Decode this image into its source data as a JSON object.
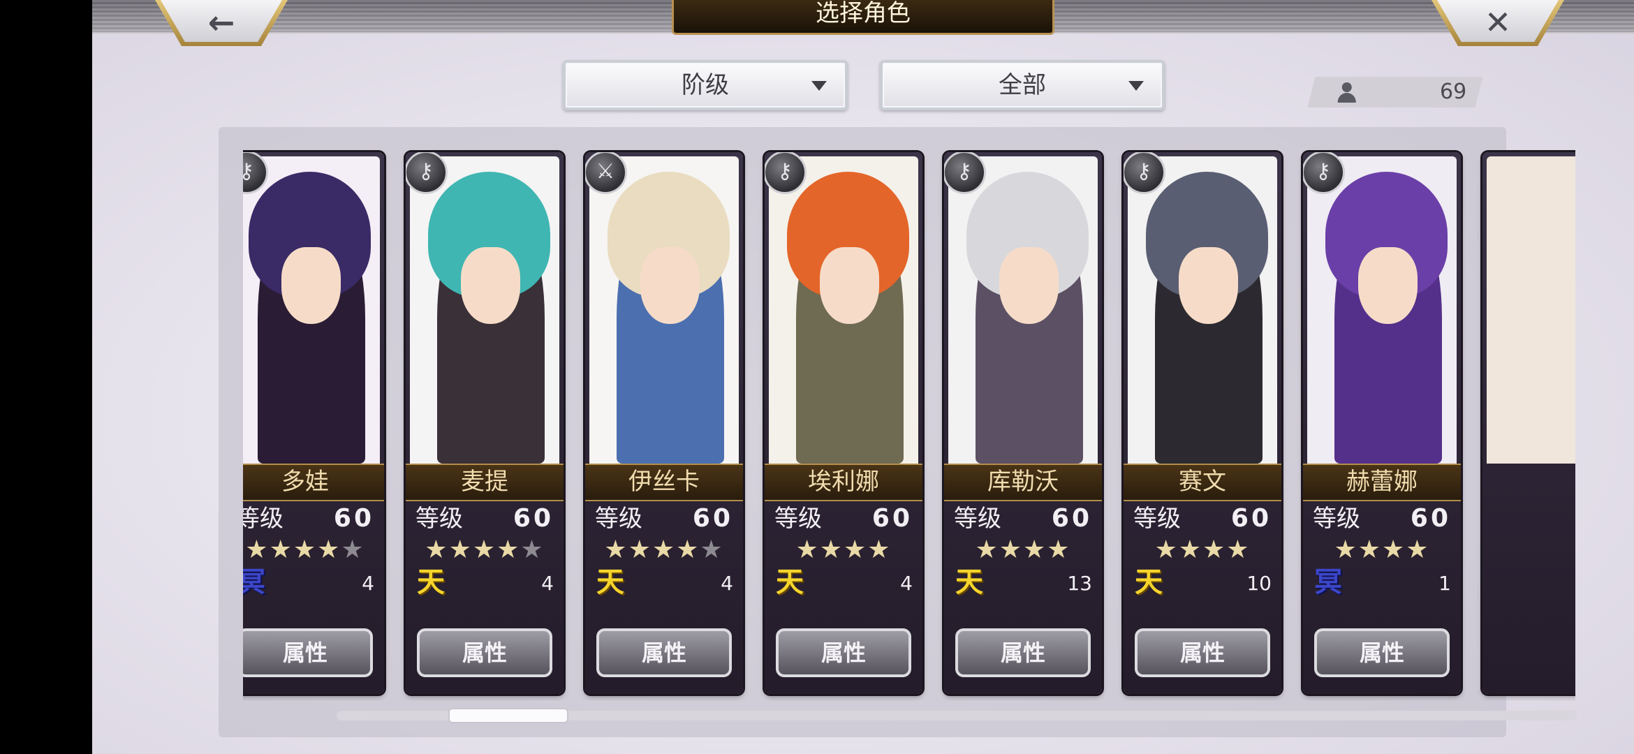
{
  "header": {
    "title": "选择角色",
    "back_icon": "←",
    "close_icon": "✕"
  },
  "filters": {
    "rank_label": "阶级",
    "type_label": "全部"
  },
  "roster_count": "69",
  "characters": [
    {
      "name": "多娃",
      "level_label": "等级",
      "level": "60",
      "stars_on": 4,
      "stars_total": 5,
      "element": "冥",
      "element_type": "ming",
      "count": "4",
      "attr_label": "属性",
      "class_icon": "key-icon",
      "hair": "#3a2a66",
      "outfit": "#2a1c34",
      "bg": "#f4eef6"
    },
    {
      "name": "麦提",
      "level_label": "等级",
      "level": "60",
      "stars_on": 4,
      "stars_total": 5,
      "element": "天",
      "element_type": "tian",
      "count": "4",
      "attr_label": "属性",
      "class_icon": "key-icon",
      "hair": "#3fb6b2",
      "outfit": "#3a3038",
      "bg": "#f4f4f4"
    },
    {
      "name": "伊丝卡",
      "level_label": "等级",
      "level": "60",
      "stars_on": 4,
      "stars_total": 5,
      "element": "天",
      "element_type": "tian",
      "count": "4",
      "attr_label": "属性",
      "class_icon": "sword-icon",
      "hair": "#e9dcc0",
      "outfit": "#4c6fb0",
      "bg": "#f6f5f3"
    },
    {
      "name": "埃利娜",
      "level_label": "等级",
      "level": "60",
      "stars_on": 4,
      "stars_total": 4,
      "element": "天",
      "element_type": "tian",
      "count": "4",
      "attr_label": "属性",
      "class_icon": "key-icon",
      "hair": "#e4652a",
      "outfit": "#6f6a52",
      "bg": "#f4f1ea"
    },
    {
      "name": "库勒沃",
      "level_label": "等级",
      "level": "60",
      "stars_on": 4,
      "stars_total": 4,
      "element": "天",
      "element_type": "tian",
      "count": "13",
      "attr_label": "属性",
      "class_icon": "key-icon",
      "hair": "#d8d8dc",
      "outfit": "#5c5064",
      "bg": "#f3f2f3"
    },
    {
      "name": "赛文",
      "level_label": "等级",
      "level": "60",
      "stars_on": 4,
      "stars_total": 4,
      "element": "天",
      "element_type": "tian",
      "count": "10",
      "attr_label": "属性",
      "class_icon": "key-icon",
      "hair": "#5a5e72",
      "outfit": "#2c2a30",
      "bg": "#f2f2f2"
    },
    {
      "name": "赫蕾娜",
      "level_label": "等级",
      "level": "60",
      "stars_on": 4,
      "stars_total": 4,
      "element": "冥",
      "element_type": "ming",
      "count": "1",
      "attr_label": "属性",
      "class_icon": "key-icon",
      "hair": "#6b3fa8",
      "outfit": "#54308a",
      "bg": "#f0ecf4"
    }
  ],
  "scroll_position_fraction": 0.1
}
